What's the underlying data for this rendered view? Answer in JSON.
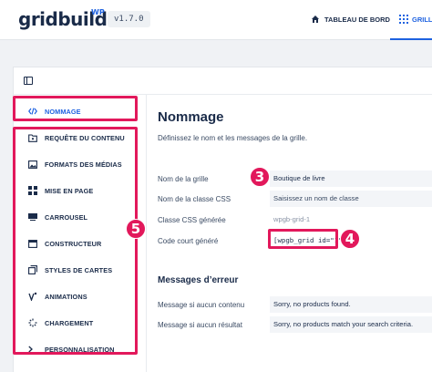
{
  "header": {
    "logo": "gridbuilder",
    "logo_sup": "WP",
    "version": "v1.7.0",
    "nav": [
      {
        "label": "TABLEAU DE BORD",
        "icon": "home-icon"
      },
      {
        "label": "GRILLES",
        "icon": "grid-icon",
        "active": true
      }
    ]
  },
  "sidebar": {
    "items": [
      {
        "label": "NOMMAGE",
        "icon": "code-icon",
        "active": true
      },
      {
        "label": "REQUÊTE DU CONTENU",
        "icon": "query-icon"
      },
      {
        "label": "FORMATS DES MÉDIAS",
        "icon": "image-icon"
      },
      {
        "label": "MISE EN PAGE",
        "icon": "layout-icon"
      },
      {
        "label": "CARROUSEL",
        "icon": "carousel-icon"
      },
      {
        "label": "CONSTRUCTEUR",
        "icon": "builder-icon"
      },
      {
        "label": "STYLES DE CARTES",
        "icon": "cards-icon"
      },
      {
        "label": "ANIMATIONS",
        "icon": "animation-icon"
      },
      {
        "label": "CHARGEMENT",
        "icon": "loader-icon"
      },
      {
        "label": "PERSONNALISATION",
        "icon": "terminal-icon"
      }
    ]
  },
  "main": {
    "title": "Nommage",
    "description": "Définissez le nom et les messages de la grille.",
    "fields": [
      {
        "label": "Nom de la grille",
        "value": "Boutique de livre"
      },
      {
        "label": "Nom de la classe CSS",
        "value": "Saisissez un nom de classe"
      },
      {
        "label": "Classe CSS générée",
        "value": "wpgb-grid-1"
      },
      {
        "label": "Code court généré",
        "value": "[wpgb_grid id=\"1\"]"
      }
    ],
    "errors_title": "Messages d’erreur",
    "errors": [
      {
        "label": "Message si aucun contenu",
        "value": "Sorry, no products found."
      },
      {
        "label": "Message si aucun résultat",
        "value": "Sorry, no products match your search criteria."
      }
    ]
  },
  "annotations": [
    "3",
    "4",
    "5"
  ],
  "colors": {
    "accent": "#1e62e0",
    "highlight": "#e2185b",
    "text": "#1a2b49"
  }
}
